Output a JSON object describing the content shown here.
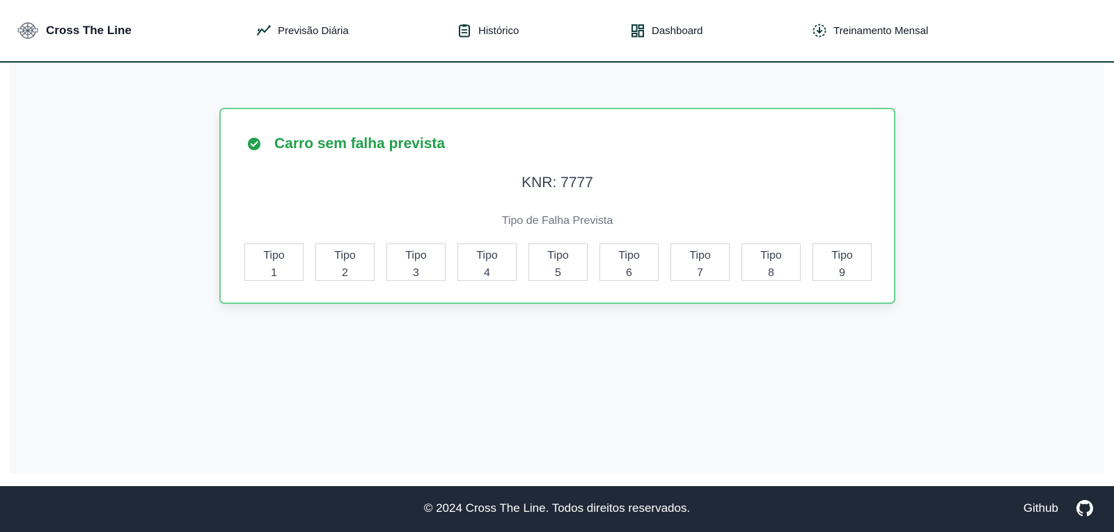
{
  "app": {
    "name": "Cross The Line",
    "accent_color": "#0f3b3a"
  },
  "nav": {
    "items": [
      {
        "label": "Previsão Diária",
        "icon": "trend-chart-icon"
      },
      {
        "label": "Histórico",
        "icon": "clipboard-icon"
      },
      {
        "label": "Dashboard",
        "icon": "dashboard-icon"
      },
      {
        "label": "Treinamento Mensal",
        "icon": "download-cycle-icon"
      }
    ]
  },
  "result": {
    "status_text": "Carro sem falha prevista",
    "status_color": "#22a04b",
    "knr_label": "KNR:",
    "knr_value": "7777",
    "failure_type_title": "Tipo de Falha Prevista",
    "types": [
      {
        "word": "Tipo",
        "number": "1"
      },
      {
        "word": "Tipo",
        "number": "2"
      },
      {
        "word": "Tipo",
        "number": "3"
      },
      {
        "word": "Tipo",
        "number": "4"
      },
      {
        "word": "Tipo",
        "number": "5"
      },
      {
        "word": "Tipo",
        "number": "6"
      },
      {
        "word": "Tipo",
        "number": "7"
      },
      {
        "word": "Tipo",
        "number": "8"
      },
      {
        "word": "Tipo",
        "number": "9"
      }
    ]
  },
  "footer": {
    "copyright": "© 2024 Cross The Line. Todos direitos reservados.",
    "github_label": "Github",
    "background": "#1f2937"
  }
}
